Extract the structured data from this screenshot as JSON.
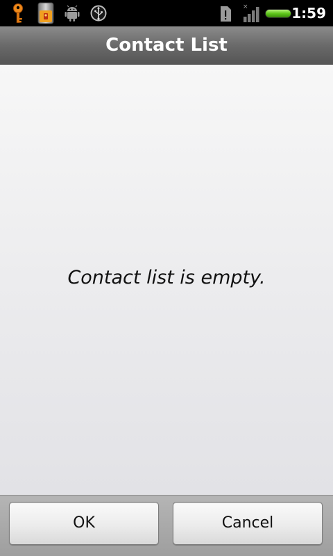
{
  "status_bar": {
    "time": "1:59",
    "icons": [
      "key-icon",
      "lock-app-icon",
      "android-debug-icon",
      "usb-icon",
      "sd-card-alert-icon",
      "signal-icon",
      "battery-icon"
    ]
  },
  "title": "Contact List",
  "content": {
    "empty_message": "Contact list is empty."
  },
  "buttons": {
    "ok_label": "OK",
    "cancel_label": "Cancel"
  },
  "colors": {
    "title_bar": "#6a6a6a",
    "content_bg": "#ececee",
    "battery": "#5ec61a"
  }
}
